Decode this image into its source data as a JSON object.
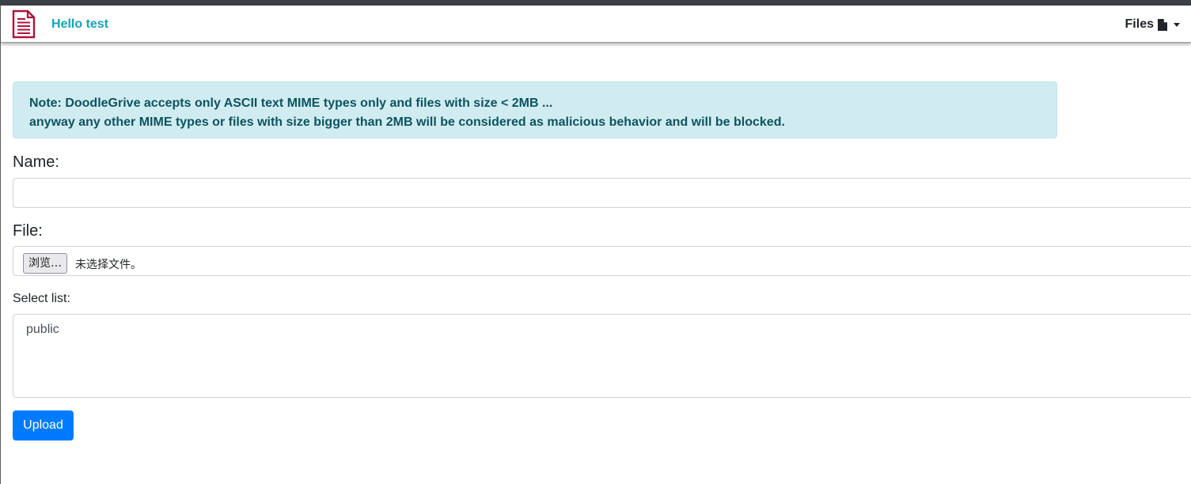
{
  "navbar": {
    "brand": "Hello test",
    "files_menu_label": "Files",
    "logo_icon": "document-lines-icon",
    "files_icon": "file-icon",
    "brand_color": "#17a2b8",
    "logo_color": "#b0123c"
  },
  "alert": {
    "line1": "Note: DoodleGrive accepts only ASCII text MIME types only and files with size < 2MB ...",
    "line2": "anyway any other MIME types or files with size bigger than 2MB will be considered as malicious behavior and will be blocked.",
    "background": "#d1ecf1",
    "text_color": "#0c5460"
  },
  "form": {
    "name_label": "Name:",
    "name_value": "",
    "file_label": "File:",
    "browse_label": "浏览…",
    "no_file_text": "未选择文件。",
    "select_label": "Select list:",
    "select_options": [
      "public"
    ],
    "upload_label": "Upload",
    "upload_color": "#007bff"
  }
}
